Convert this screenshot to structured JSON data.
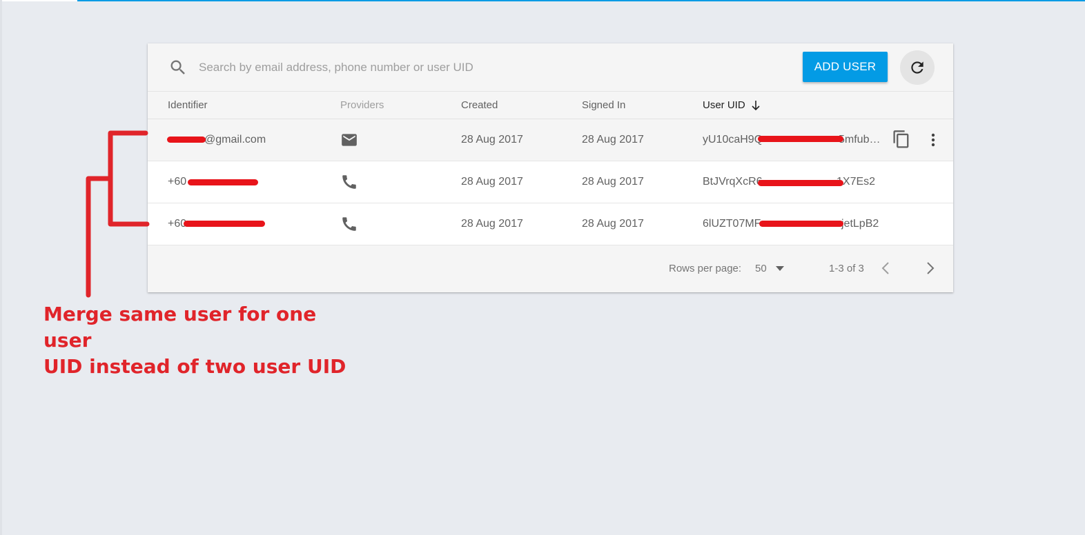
{
  "search": {
    "placeholder": "Search by email address, phone number or user UID"
  },
  "toolbar": {
    "add_user_label": "ADD USER"
  },
  "table": {
    "columns": [
      "Identifier",
      "Providers",
      "Created",
      "Signed In",
      "User UID"
    ],
    "rows": [
      {
        "identifier": "@gmail.com",
        "provider": "email-icon",
        "created": "28 Aug 2017",
        "signed_in": "28 Aug 2017",
        "uid": "yU10caH9Q",
        "uid_end": "5mfub…"
      },
      {
        "identifier": "+60",
        "provider": "phone-icon",
        "created": "28 Aug 2017",
        "signed_in": "28 Aug 2017",
        "uid": "BtJVrqXcR6",
        "uid_end": "1X7Es2"
      },
      {
        "identifier": "+60",
        "provider": "phone-icon",
        "created": "28 Aug 2017",
        "signed_in": "28 Aug 2017",
        "uid": "6lUZT07MF",
        "uid_end": "jetLpB2"
      }
    ]
  },
  "pagination": {
    "rows_per_page_label": "Rows per page:",
    "rows_per_page_value": "50",
    "range": "1-3 of 3"
  },
  "annotation": {
    "line1": "Merge same user for one user",
    "line2": "UID instead of two user UID",
    "color": "#e0242a"
  },
  "colors": {
    "accent": "#039be5",
    "background": "#e8ebf0",
    "redaction": "#e8141a"
  }
}
